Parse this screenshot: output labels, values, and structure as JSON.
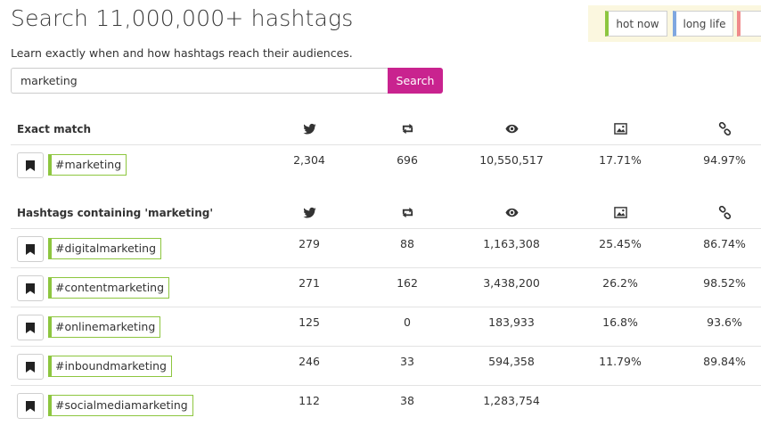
{
  "header": {
    "title": "Search 11,000,000+ hashtags",
    "subtitle": "Learn exactly when and how hashtags reach their audiences."
  },
  "legend": {
    "hot_now": "hot now",
    "long_life": "long life",
    "colors": {
      "hot_now": "#8dc63f",
      "long_life": "#7fa7e0",
      "third": "#f08b8b",
      "background": "#fbf7df"
    }
  },
  "search": {
    "value": "marketing",
    "button_label": "Search",
    "button_color": "#c9238f"
  },
  "columns": {
    "icons": [
      "twitter-icon",
      "retweet-icon",
      "eye-icon",
      "image-icon",
      "link-icon"
    ]
  },
  "exact_match": {
    "title": "Exact match",
    "rows": [
      {
        "hashtag": "#marketing",
        "tweets": "2,304",
        "retweets": "696",
        "views": "10,550,517",
        "images": "17.71%",
        "links": "94.97%"
      }
    ]
  },
  "containing": {
    "title": "Hashtags containing 'marketing'",
    "rows": [
      {
        "hashtag": "#digitalmarketing",
        "tweets": "279",
        "retweets": "88",
        "views": "1,163,308",
        "images": "25.45%",
        "links": "86.74%"
      },
      {
        "hashtag": "#contentmarketing",
        "tweets": "271",
        "retweets": "162",
        "views": "3,438,200",
        "images": "26.2%",
        "links": "98.52%"
      },
      {
        "hashtag": "#onlinemarketing",
        "tweets": "125",
        "retweets": "0",
        "views": "183,933",
        "images": "16.8%",
        "links": "93.6%"
      },
      {
        "hashtag": "#inboundmarketing",
        "tweets": "246",
        "retweets": "33",
        "views": "594,358",
        "images": "11.79%",
        "links": "89.84%"
      },
      {
        "hashtag": "#socialmediamarketing",
        "tweets": "112",
        "retweets": "38",
        "views": "1,283,754",
        "images": "",
        "links": ""
      }
    ]
  }
}
